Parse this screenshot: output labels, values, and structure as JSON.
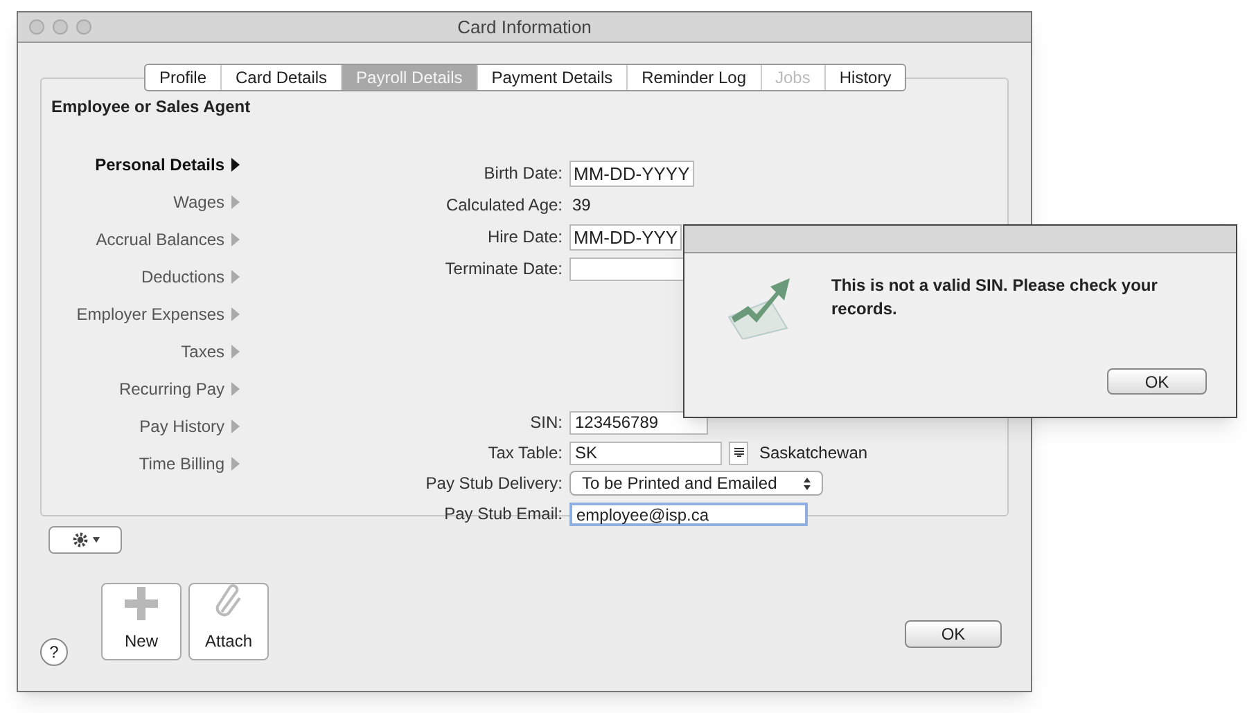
{
  "window": {
    "title": "Card Information"
  },
  "tabs": [
    {
      "label": "Profile",
      "selected": false,
      "disabled": false
    },
    {
      "label": "Card Details",
      "selected": false,
      "disabled": false
    },
    {
      "label": "Payroll Details",
      "selected": true,
      "disabled": false
    },
    {
      "label": "Payment Details",
      "selected": false,
      "disabled": false
    },
    {
      "label": "Reminder Log",
      "selected": false,
      "disabled": false
    },
    {
      "label": "Jobs",
      "selected": false,
      "disabled": true
    },
    {
      "label": "History",
      "selected": false,
      "disabled": false
    }
  ],
  "card_type": "Employee or Sales Agent",
  "sections": [
    {
      "label": "Personal Details",
      "selected": true
    },
    {
      "label": "Wages",
      "selected": false
    },
    {
      "label": "Accrual Balances",
      "selected": false
    },
    {
      "label": "Deductions",
      "selected": false
    },
    {
      "label": "Employer Expenses",
      "selected": false
    },
    {
      "label": "Taxes",
      "selected": false
    },
    {
      "label": "Recurring Pay",
      "selected": false
    },
    {
      "label": "Pay History",
      "selected": false
    },
    {
      "label": "Time Billing",
      "selected": false
    }
  ],
  "form_top": [
    {
      "kind": "date",
      "label": "Birth Date:",
      "value": "MM-DD-YYYY"
    },
    {
      "kind": "text",
      "label": "Calculated Age:",
      "value": "39"
    },
    {
      "kind": "date",
      "label": "Hire Date:",
      "value": "MM-DD-YYY"
    },
    {
      "kind": "field",
      "label": "Terminate Date:"
    }
  ],
  "form_bottom": [
    {
      "kind": "field",
      "label": "SIN:",
      "value": "123456789"
    },
    {
      "kind": "lookup",
      "label": "Tax Table:",
      "value": "SK",
      "note": "Saskatchewan"
    },
    {
      "kind": "popup",
      "label": "Pay Stub Delivery:",
      "value": "To be Printed and Emailed"
    },
    {
      "kind": "field",
      "label": "Pay Stub Email:",
      "value": "employee@isp.ca",
      "focused": true
    }
  ],
  "toolbar": [
    {
      "label": "New",
      "kind": "new"
    },
    {
      "label": "Attach",
      "kind": "attach"
    }
  ],
  "help": "?",
  "ok": "OK",
  "alert": {
    "message": "This is not a valid SIN.  Please check your records.",
    "button": "OK"
  }
}
